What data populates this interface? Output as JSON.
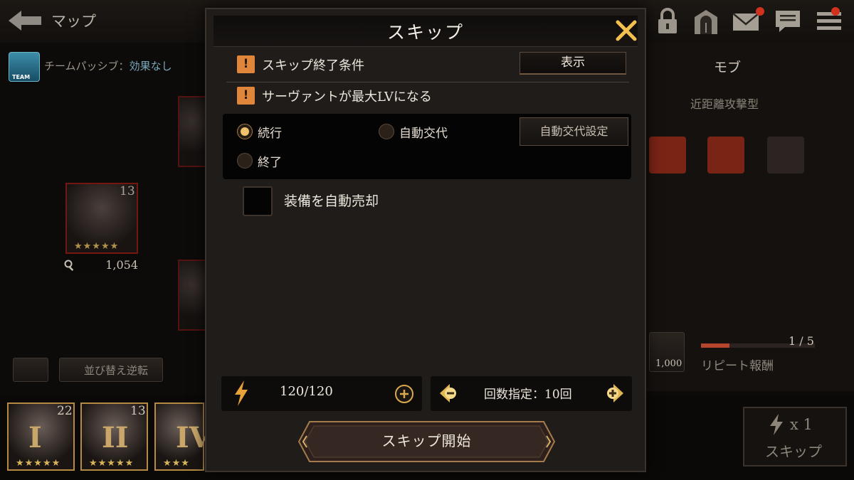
{
  "background": {
    "header": {
      "title": "マップ"
    },
    "team": {
      "icon_label": "TEAM",
      "passive_label": "チームパッシブ：",
      "passive_value": "効果なし"
    },
    "formation": {
      "main_card": {
        "level": "13",
        "stars": "★★★★★",
        "power": "1,054"
      },
      "sort_button": "並び替え逆転"
    },
    "enemy_panel": {
      "name": "モブ",
      "type": "近距離攻撃型"
    },
    "reward": {
      "coin_value": "1,000",
      "label": "リピート報酬",
      "count": "1 / 5",
      "progress": 0.25
    },
    "roster": [
      {
        "numeral": "I",
        "level": "22",
        "stars": "★★★★★"
      },
      {
        "numeral": "II",
        "level": "13",
        "stars": "★★★★★"
      },
      {
        "numeral": "IV",
        "level": "",
        "stars": "★★★"
      }
    ],
    "skip_button": {
      "multiplier": "x 1",
      "label": "スキップ"
    }
  },
  "modal": {
    "title": "スキップ",
    "end_condition": {
      "label": "スキップ終了条件",
      "show_button": "表示"
    },
    "condition": {
      "label": "サーヴァントが最大LVになる"
    },
    "options": {
      "continue": "続行",
      "auto_swap": "自動交代",
      "end": "終了",
      "selected": "continue",
      "auto_swap_settings": "自動交代設定"
    },
    "auto_sell": {
      "label": "装備を自動売却",
      "checked": false
    },
    "stamina": {
      "value": "120/120"
    },
    "count": {
      "label": "回数指定：10回"
    },
    "start_button": "スキップ開始"
  },
  "colors": {
    "accent": "#f1c16b",
    "warning": "#e0863a",
    "frame_red": "#8e1b15"
  }
}
